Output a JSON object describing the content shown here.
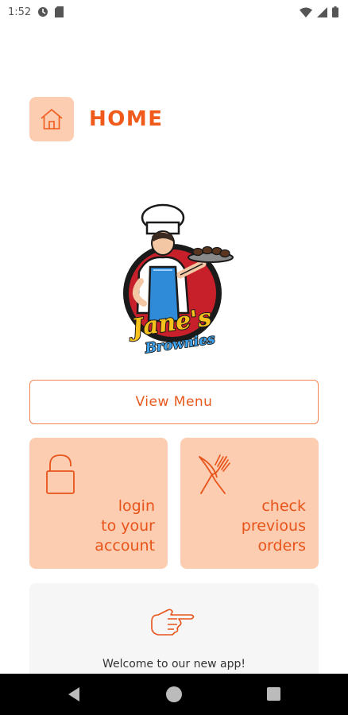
{
  "status_bar": {
    "time": "1:52",
    "icons": [
      "data-saver-icon",
      "sd-card-icon",
      "wifi-icon",
      "signal-icon",
      "battery-icon"
    ]
  },
  "header": {
    "title": "HOME",
    "icon": "home-icon"
  },
  "logo": {
    "line1": "Jane's",
    "line2": "Brownies"
  },
  "actions": {
    "view_menu": "View Menu",
    "login": "login\nto your\naccount",
    "orders": "check\nprevious\norders"
  },
  "welcome": {
    "text": "Welcome to our new app!",
    "icon": "pointing-hand-icon"
  },
  "colors": {
    "accent": "#f05a1a",
    "card": "#fccdb1",
    "border": "#f28455"
  }
}
